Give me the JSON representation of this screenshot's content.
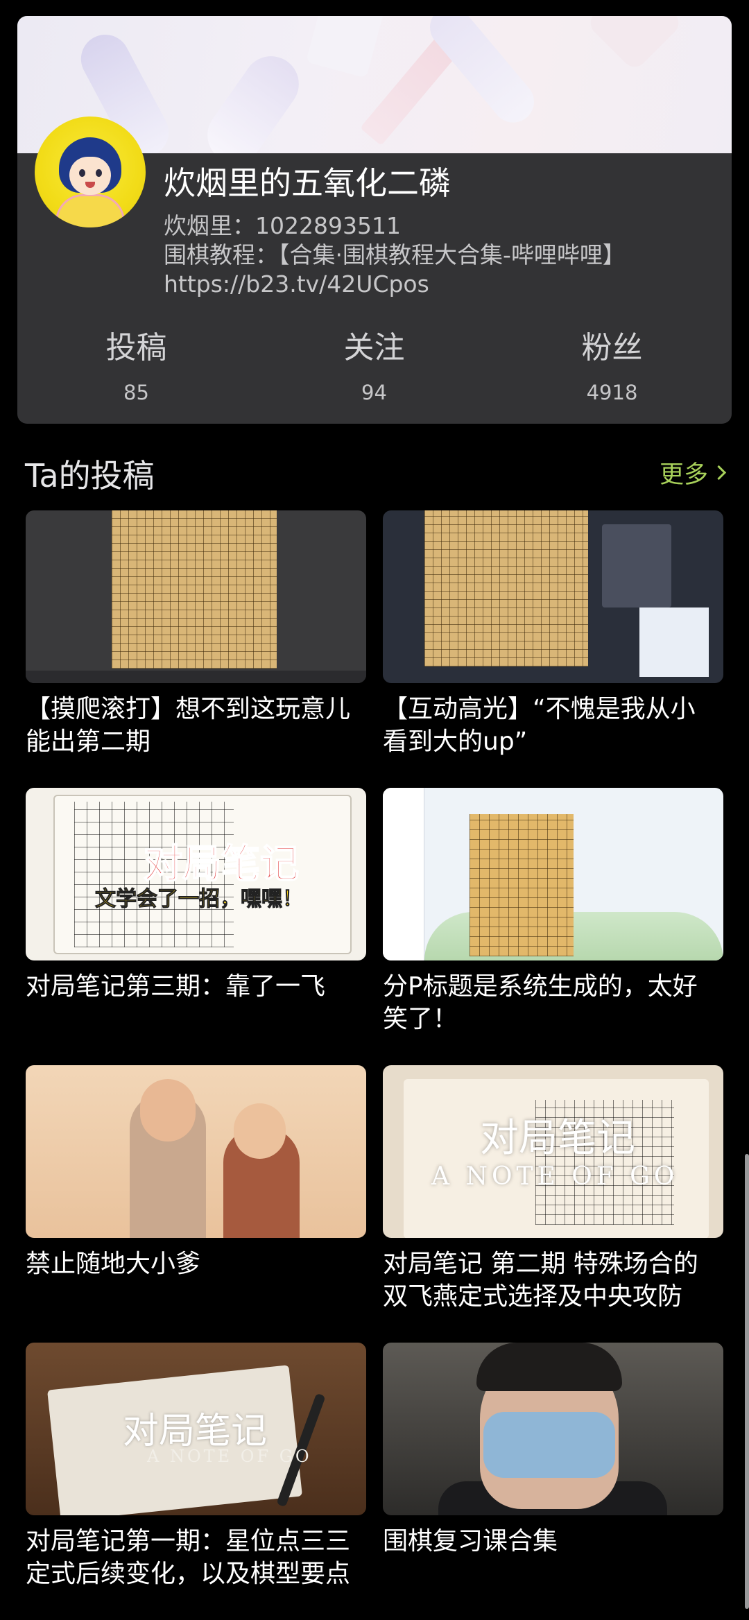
{
  "profile": {
    "name": "炊烟里的五氧化二磷",
    "bio_lines": [
      "炊烟里：1022893511",
      "围棋教程：【合集·围棋教程大合集-哔哩哔哩】",
      "https://b23.tv/42UCpos"
    ],
    "stats": [
      {
        "label": "投稿",
        "value": "85"
      },
      {
        "label": "关注",
        "value": "94"
      },
      {
        "label": "粉丝",
        "value": "4918"
      }
    ]
  },
  "section": {
    "title": "Ta的投稿",
    "more_label": "更多"
  },
  "videos": [
    {
      "title": "【摸爬滚打】想不到这玩意儿能出第二期"
    },
    {
      "title": "【互动高光】“不愧是我从小看到大的up”"
    },
    {
      "title": "对局笔记第三期：靠了一飞",
      "thumb_text": "对局笔记",
      "thumb_sub": "文学会了一招，嘿嘿！"
    },
    {
      "title": "分P标题是系统生成的，太好笑了！"
    },
    {
      "title": "禁止随地大小爹"
    },
    {
      "title": "对局笔记 第二期 特殊场合的双飞燕定式选择及中央攻防",
      "thumb_text": "对局笔记",
      "thumb_sub": "A NOTE OF GO"
    },
    {
      "title": "对局笔记第一期：星位点三三定式后续变化，以及棋型要点",
      "thumb_text": "对局笔记",
      "thumb_sub": "A NOTE OF GO"
    },
    {
      "title": "围棋复习课合集"
    }
  ],
  "colors": {
    "background": "#000000",
    "card": "#333335",
    "accent": "#a8d15a"
  },
  "icons": {
    "more": "chevron-right-icon"
  }
}
